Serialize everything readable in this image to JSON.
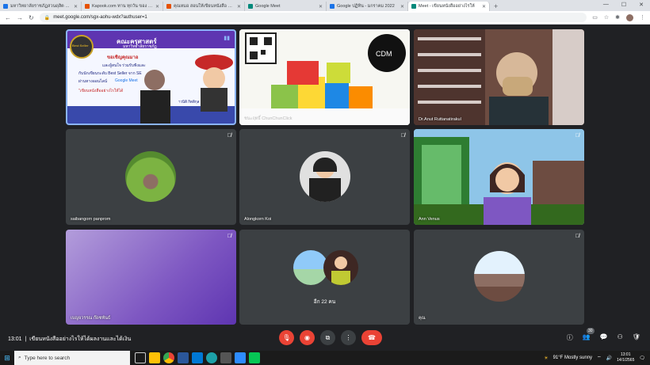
{
  "browser": {
    "tabs": [
      {
        "title": "มหาวิทยาลัยราชภัฏสวนดุสิต Suan Dusit Ur",
        "color": "#1a73e8",
        "active": false
      },
      {
        "title": "Kapook.com ทาน ทุกวัน ของ ดี ทุก",
        "color": "#e65100",
        "active": false
      },
      {
        "title": "คุณหมอ สอนให้เขียนหนังสือ ขอบคุณ",
        "color": "#e65100",
        "active": false
      },
      {
        "title": "Google Meet",
        "color": "#00897b",
        "active": false
      },
      {
        "title": "Google ปฏิทิน - มกราคม 2022",
        "color": "#1a73e8",
        "active": false
      },
      {
        "title": "Meet - เขียนหนังสืออย่างไรให้",
        "color": "#00897b",
        "active": true
      }
    ],
    "new_tab": "+",
    "url": "meet.google.com/sgx-aohu-wdx?authuser=1"
  },
  "participants": [
    {
      "name": "",
      "type": "video"
    },
    {
      "name": "ชนะฤทธิ์ ChunChunClick",
      "type": "video"
    },
    {
      "name": "Dr.Anut Ruttanatirakul",
      "type": "video"
    },
    {
      "name": "saibangorn panprom",
      "type": "avatar"
    },
    {
      "name": "Alongkorn Koi",
      "type": "avatar"
    },
    {
      "name": "Ann Venus",
      "type": "video"
    },
    {
      "name": "เบญจวรรณ ก๊ดชพันธ์",
      "type": "blank"
    },
    {
      "name": "อีก 22 คน",
      "type": "group"
    },
    {
      "name": "คุณ",
      "type": "avatar"
    }
  ],
  "slide": {
    "faculty": "คณะครุศาสตร์",
    "university": "มหาวิทยาลัยราชภัฏ",
    "invite": "ขอเชิญคุณมาอ",
    "line1": "และผู้สนใจ ร่วมรับฟังและ",
    "line2": "กับนักเขียนระดับ Best Seller จาก SE",
    "line3": "ผ่านทางออนไลน์",
    "platform": "Google Meet",
    "line4": "\"เขียนหนังสืออย่างไรให้ได้",
    "speaker": "าวนิติ กิตติกุล",
    "badge": "Best Seller"
  },
  "meeting": {
    "time": "13:01",
    "title": "เขียนหนังสืออย่างไรให้ได้ผลงานและได้เงิน",
    "participant_count": "30"
  },
  "taskbar": {
    "search_placeholder": "Type here to search",
    "weather": "91°F  Mostly sunny",
    "clock_time": "13:01",
    "clock_date": "14/1/2565"
  },
  "colors": {
    "meet_bg": "#202124",
    "tile_bg": "#3c4043",
    "end_call": "#ea4335"
  }
}
